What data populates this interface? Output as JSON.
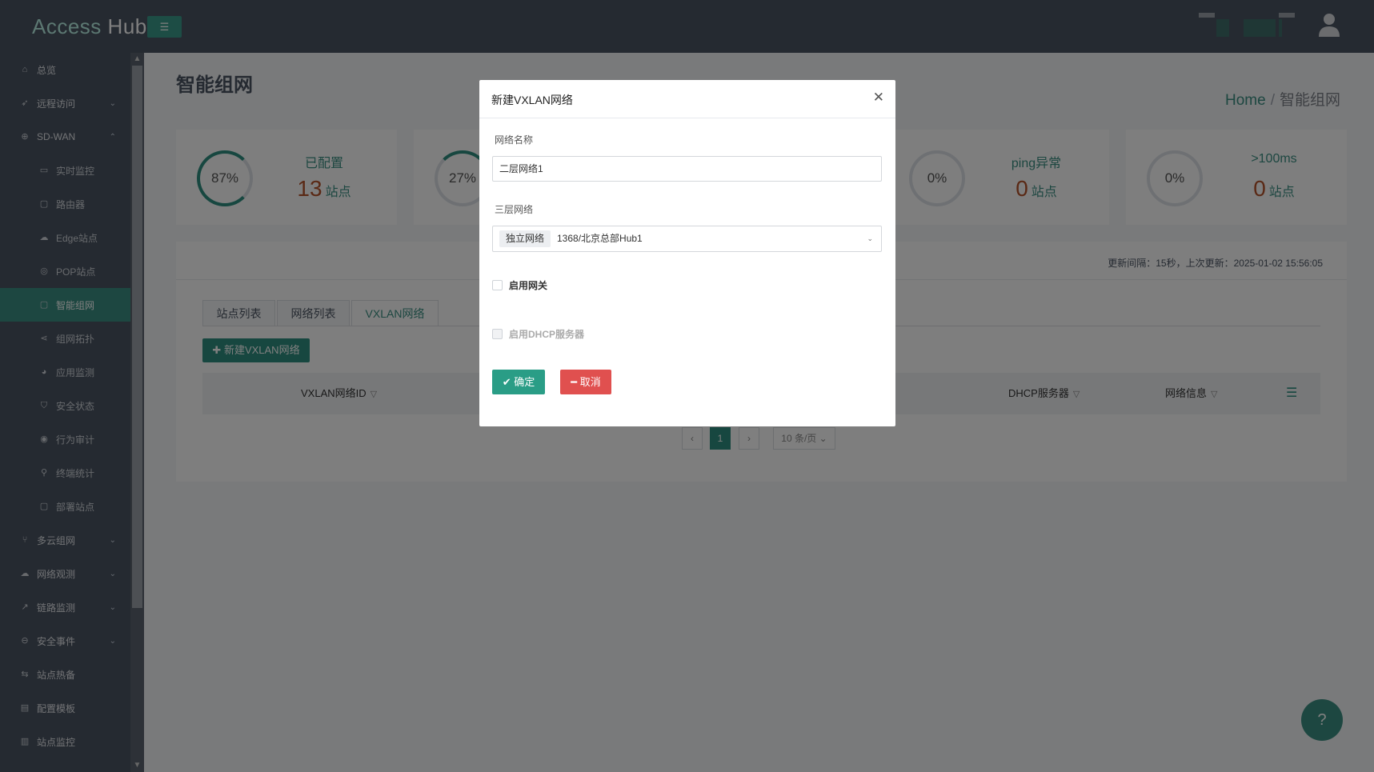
{
  "app": {
    "logo_part1": "Access",
    "logo_part2": "Hub"
  },
  "sidebar": {
    "items": [
      {
        "label": "总览",
        "icon": "home-icon"
      },
      {
        "label": "远程访问",
        "icon": "rocket-icon"
      },
      {
        "label": "SD-WAN",
        "icon": "globe-icon"
      },
      {
        "label": "实时监控",
        "icon": "monitor-icon"
      },
      {
        "label": "路由器",
        "icon": "router-icon"
      },
      {
        "label": "Edge站点",
        "icon": "cloud-icon"
      },
      {
        "label": "POP站点",
        "icon": "location-icon"
      },
      {
        "label": "智能组网",
        "icon": "network-icon"
      },
      {
        "label": "组网拓扑",
        "icon": "share-icon"
      },
      {
        "label": "应用监测",
        "icon": "pie-icon"
      },
      {
        "label": "安全状态",
        "icon": "shield-icon"
      },
      {
        "label": "行为审计",
        "icon": "eye-icon"
      },
      {
        "label": "终端统计",
        "icon": "search-icon"
      },
      {
        "label": "部署站点",
        "icon": "deploy-icon"
      },
      {
        "label": "多云组网",
        "icon": "branch-icon"
      },
      {
        "label": "网络观测",
        "icon": "cloud-outline-icon"
      },
      {
        "label": "链路监测",
        "icon": "chart-line-icon"
      },
      {
        "label": "安全事件",
        "icon": "minus-circle-icon"
      },
      {
        "label": "站点热备",
        "icon": "swap-icon"
      },
      {
        "label": "配置模板",
        "icon": "file-icon"
      },
      {
        "label": "站点监控",
        "icon": "bar-chart-icon"
      }
    ]
  },
  "page": {
    "title": "智能组网",
    "breadcrumb": {
      "home": "Home",
      "current": "智能组网"
    }
  },
  "stats": [
    {
      "percent": "87%",
      "label": "已配置",
      "value": "13",
      "unit": "站点",
      "fill": 0.87
    },
    {
      "percent": "27%",
      "label": "",
      "value": "",
      "unit": "",
      "fill": 0.27
    },
    {
      "percent": "0%",
      "label": "ping异常",
      "value": "0",
      "unit": "站点",
      "fill": 0
    },
    {
      "percent": "0%",
      "label": ">100ms",
      "value": "0",
      "unit": "站点",
      "fill": 0
    }
  ],
  "panel": {
    "update_text": "更新间隔：15秒，上次更新：2025-01-02 15:56:05",
    "tabs": [
      "站点列表",
      "网络列表",
      "VXLAN网络"
    ],
    "new_button": "新建VXLAN网络",
    "columns": [
      "VXLAN网络ID",
      "DHCP服务器",
      "网络信息"
    ],
    "pagination": {
      "prev": "‹",
      "current": "1",
      "next": "›",
      "page_size": "10 条/页"
    }
  },
  "modal": {
    "title": "新建VXLAN网络",
    "field_name_label": "网络名称",
    "field_name_value": "二层网络1",
    "field_l3_label": "三层网络",
    "field_l3_tag": "独立网络",
    "field_l3_value": "1368/北京总部Hub1",
    "gateway_label": "启用网关",
    "dhcp_label": "启用DHCP服务器",
    "ok_label": "确定",
    "cancel_label": "取消"
  },
  "colors": {
    "accent": "#2f8e80",
    "danger": "#e0504f",
    "sidebar": "#4b5563",
    "stat_value": "#b5532b"
  }
}
